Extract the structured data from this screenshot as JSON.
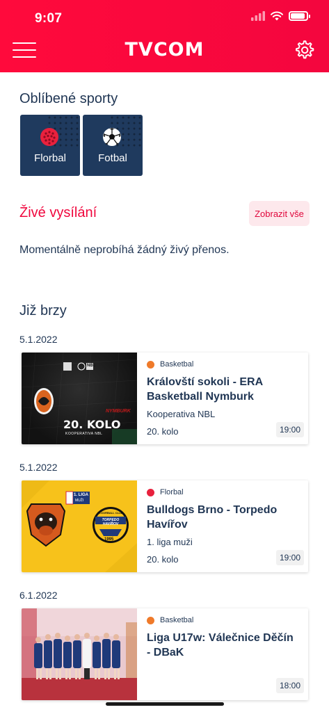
{
  "status_bar": {
    "time": "9:07"
  },
  "header": {
    "logo": "TVCOM"
  },
  "favorites": {
    "title": "Oblíbené sporty",
    "items": [
      {
        "label": "Florbal",
        "icon": "floorball-icon"
      },
      {
        "label": "Fotbal",
        "icon": "football-icon"
      }
    ]
  },
  "live": {
    "title": "Živé vysílání",
    "show_all_label": "Zobrazit vše",
    "empty_text": "Momentálně neprobíhá žádný živý přenos."
  },
  "upcoming": {
    "title": "Již brzy",
    "items": [
      {
        "date": "5.1.2022",
        "sport": "Basketbal",
        "match": "Královští sokoli - ERA Basketball Nymburk",
        "league": "Kooperativa NBL",
        "round": "20. kolo",
        "time": "19:00",
        "thumb": {
          "round_text": "20. KOLO",
          "sub_text": "KOOPERATIVA NBL",
          "brand_text": "NYMBURK",
          "nbl_text": "NBL"
        }
      },
      {
        "date": "5.1.2022",
        "sport": "Florbal",
        "match": "Bulldogs Brno - Torpedo Havířov",
        "league": "1. liga muži",
        "round": "20. kolo",
        "time": "19:00",
        "thumb": {
          "liga_text": "1. LIGA",
          "muzi_text": "MUŽI",
          "club_text": "FLOORBALL CLUB",
          "torpedo_text": "TORPEDO HAVÍŘOV",
          "year_text": "1995"
        }
      },
      {
        "date": "6.1.2022",
        "sport": "Basketbal",
        "match": "Liga U17w: Válečnice Děčín - DBaK",
        "time": "18:00"
      }
    ]
  },
  "colors": {
    "brand_red": "#f4063e",
    "navy": "#1f3553",
    "tile_navy": "#1f3a5e",
    "basketball_orange": "#ef7a2a",
    "floorball_red": "#e8213d",
    "yellow": "#f7c21b"
  }
}
